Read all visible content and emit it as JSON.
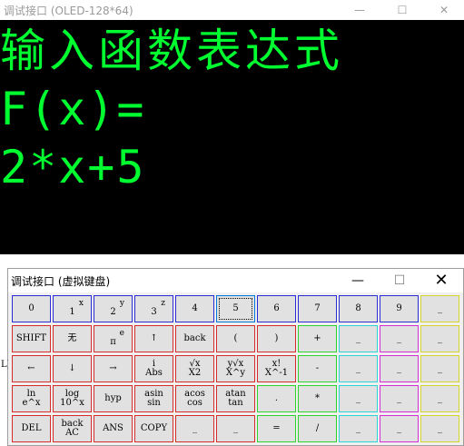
{
  "main": {
    "title": "调试接口 (OLED-128*64)",
    "controls": {
      "minimize": "—",
      "maximize": "☐",
      "close": "✕"
    },
    "oled": {
      "line1": "输入函数表达式",
      "line2": "F(x)=",
      "line3": "2*x+5",
      "text_color": "#00ff30",
      "background": "#000000"
    }
  },
  "keyboard": {
    "title": "调试接口 (虚拟键盘)",
    "controls": {
      "minimize": "—",
      "maximize": "☐",
      "close": "✕"
    },
    "edge_label": "L)",
    "rows": [
      [
        {
          "main": "0",
          "sup": "",
          "color": "blue"
        },
        {
          "main": "1",
          "sup": "x",
          "color": "blue"
        },
        {
          "main": "2",
          "sup": "y",
          "color": "blue"
        },
        {
          "main": "3",
          "sup": "z",
          "color": "blue"
        },
        {
          "main": "4",
          "sup": "",
          "color": "blue"
        },
        {
          "main": "5",
          "sup": "",
          "color": "blue",
          "focused": true
        },
        {
          "main": "6",
          "sup": "",
          "color": "blue"
        },
        {
          "main": "7",
          "sup": "",
          "color": "blue"
        },
        {
          "main": "8",
          "sup": "",
          "color": "blue"
        },
        {
          "main": "9",
          "sup": "",
          "color": "blue"
        },
        {
          "main": "_",
          "sup": "",
          "color": "yellow"
        }
      ],
      [
        {
          "main": "SHIFT",
          "sup": "",
          "color": "red"
        },
        {
          "main": "无",
          "sup": "",
          "color": "red"
        },
        {
          "main": "π",
          "sup": "e",
          "color": "red"
        },
        {
          "main": "↑",
          "sup": "",
          "color": "red"
        },
        {
          "main": "back",
          "sup": "",
          "color": "red"
        },
        {
          "main": "(",
          "sup": "",
          "color": "red"
        },
        {
          "main": ")",
          "sup": "",
          "color": "red"
        },
        {
          "main": "+",
          "sup": "",
          "color": "green"
        },
        {
          "main": "_",
          "sup": "",
          "color": "cyan"
        },
        {
          "main": "_",
          "sup": "",
          "color": "magenta"
        },
        {
          "main": "_",
          "sup": "",
          "color": "yellow"
        }
      ],
      [
        {
          "main": "←",
          "sup": "",
          "color": "red"
        },
        {
          "main": "↓",
          "sup": "",
          "color": "red"
        },
        {
          "main": "→",
          "sup": "",
          "color": "red"
        },
        {
          "main": "i\nAbs",
          "sup": "",
          "color": "red"
        },
        {
          "main": "√x\nX2",
          "sup": "",
          "color": "red"
        },
        {
          "main": "y√x\nX^y",
          "sup": "",
          "color": "red"
        },
        {
          "main": "x!\nX^-1",
          "sup": "",
          "color": "red"
        },
        {
          "main": "-",
          "sup": "",
          "color": "green"
        },
        {
          "main": "_",
          "sup": "",
          "color": "cyan"
        },
        {
          "main": "_",
          "sup": "",
          "color": "magenta"
        },
        {
          "main": "_",
          "sup": "",
          "color": "yellow"
        }
      ],
      [
        {
          "main": "ln\ne^x",
          "sup": "",
          "color": "red"
        },
        {
          "main": "log\n10^x",
          "sup": "",
          "color": "red"
        },
        {
          "main": "hyp",
          "sup": "",
          "color": "red"
        },
        {
          "main": "asin\nsin",
          "sup": "",
          "color": "red"
        },
        {
          "main": "acos\ncos",
          "sup": "",
          "color": "red"
        },
        {
          "main": "atan\ntan",
          "sup": "",
          "color": "red"
        },
        {
          "main": ".",
          "sup": "",
          "color": "green"
        },
        {
          "main": "*",
          "sup": "",
          "color": "green"
        },
        {
          "main": "_",
          "sup": "",
          "color": "cyan"
        },
        {
          "main": "_",
          "sup": "",
          "color": "magenta"
        },
        {
          "main": "_",
          "sup": "",
          "color": "yellow"
        }
      ],
      [
        {
          "main": "DEL",
          "sup": "",
          "color": "red"
        },
        {
          "main": "back\nAC",
          "sup": "",
          "color": "red"
        },
        {
          "main": "ANS",
          "sup": "",
          "color": "red"
        },
        {
          "main": "COPY",
          "sup": "",
          "color": "red"
        },
        {
          "main": "_",
          "sup": "",
          "color": "red"
        },
        {
          "main": "_",
          "sup": "",
          "color": "red"
        },
        {
          "main": "=",
          "sup": "",
          "color": "green"
        },
        {
          "main": "/",
          "sup": "",
          "color": "green"
        },
        {
          "main": "_",
          "sup": "",
          "color": "cyan"
        },
        {
          "main": "_",
          "sup": "",
          "color": "magenta"
        },
        {
          "main": "_",
          "sup": "",
          "color": "yellow"
        }
      ]
    ]
  }
}
